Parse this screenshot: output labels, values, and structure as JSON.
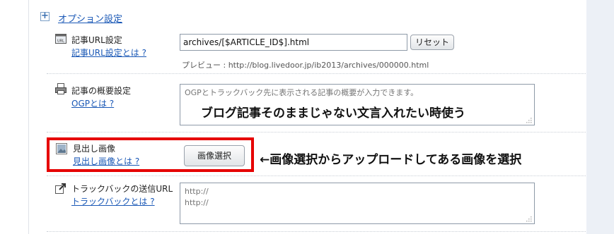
{
  "section": {
    "expand_symbol": "+",
    "title": "オプション設定"
  },
  "url_setting": {
    "label": "記事URL設定",
    "help_link": "記事URL設定とは ?",
    "value": "archives/[$ARTICLE_ID$].html",
    "reset_label": "リセット",
    "preview_text": "プレビュー : http://blog.livedoor.jp/ib2013/archives/000000.html",
    "icon": "url-icon"
  },
  "summary_setting": {
    "label": "記事の概要設定",
    "help_link": "OGPとは ?",
    "placeholder": "OGPとトラックバック先に表示される記事の概要が入力できます。",
    "icon": "summary-icon"
  },
  "heading_image": {
    "label": "見出し画像",
    "help_link": "見出し画像とは ?",
    "select_button_label": "画像選択",
    "icon": "image-icon"
  },
  "trackback": {
    "label": "トラックバックの送信URL",
    "help_link": "トラックバックとは ?",
    "placeholder": "http://\nhttp://",
    "icon": "trackback-icon"
  },
  "annotations": {
    "summary_note": "ブログ記事そのままじゃない文言入れたい時使う",
    "image_note": "←画像選択からアップロードしてある画像を選択",
    "highlight_color": "#e60000"
  }
}
